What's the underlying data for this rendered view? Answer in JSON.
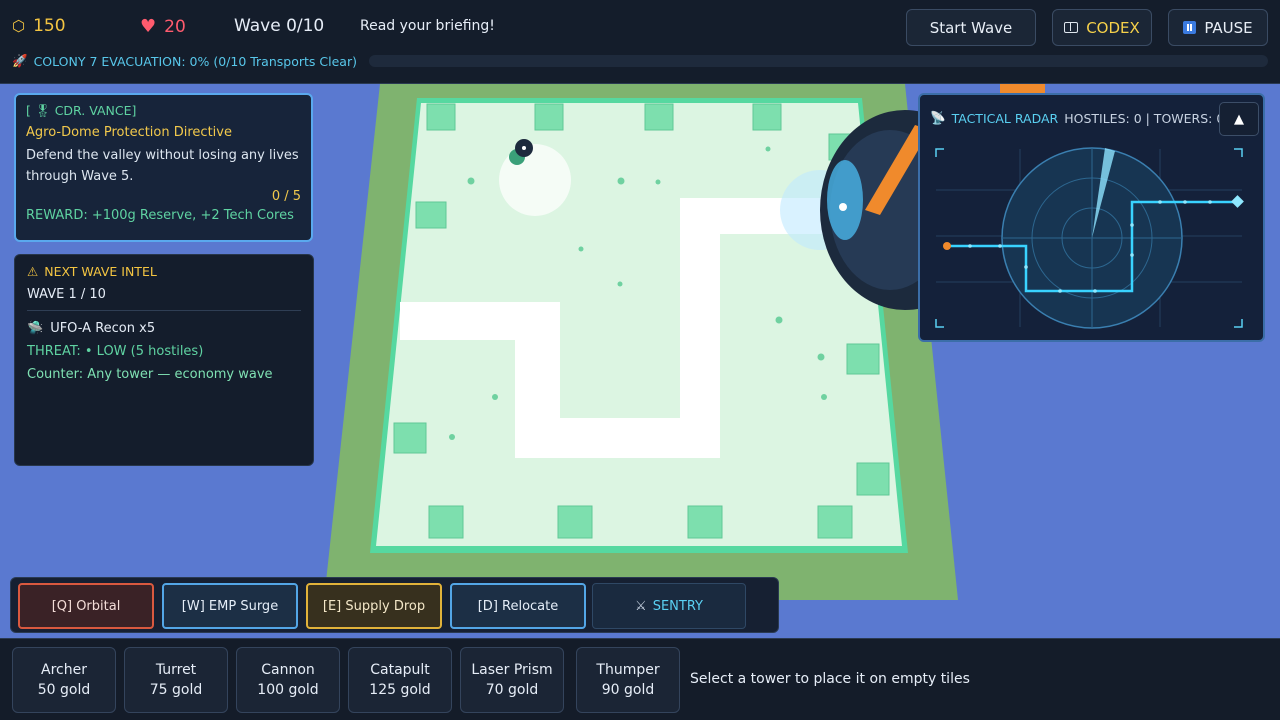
{
  "hud": {
    "gold": "150",
    "lives": "20",
    "wave": "Wave 0/10",
    "briefing": "Read your briefing!",
    "start_wave_label": "Start Wave",
    "codex_label": "CODEX",
    "pause_label": "PAUSE",
    "gold_icon": "hexagon-coin",
    "lives_icon": "heart",
    "codex_icon": "book",
    "pause_icon": "pause",
    "evacuation_text": "COLONY 7 EVACUATION: 0% (0/10 Transports Clear)",
    "evacuation_progress": 0,
    "evacuation_icon": "rocket"
  },
  "mission": {
    "commander": "[ 🎖 CDR. VANCE]",
    "title": "Agro-Dome Protection Directive",
    "description": "Defend the valley without losing any lives through Wave 5.",
    "progress": "0 / 5",
    "reward": "REWARD: +100g Reserve, +2 Tech Cores"
  },
  "intel": {
    "header": "NEXT WAVE INTEL",
    "header_icon": "warning",
    "wave": "WAVE 1 / 10",
    "enemy": "UFO-A Recon x5",
    "enemy_icon": "ufo",
    "threat": "THREAT: • LOW  (5 hostiles)",
    "counter": "Counter: Any tower — economy wave"
  },
  "radar": {
    "title": "TACTICAL RADAR",
    "stats": "HOSTILES: 0 | TOWERS: 0",
    "toggle_icon": "triangle-up",
    "toggle_label": "▲",
    "radar_icon": "satellite"
  },
  "abilities": [
    {
      "key": "orbital",
      "label": "[Q] Orbital"
    },
    {
      "key": "emp",
      "label": "[W] EMP Surge"
    },
    {
      "key": "supply",
      "label": "[E] Supply Drop"
    },
    {
      "key": "relocate",
      "label": "[D] Relocate"
    },
    {
      "key": "sentry",
      "label": "SENTRY"
    }
  ],
  "sentry_icon": "crossed-swords",
  "towers": [
    {
      "name": "Archer",
      "cost": "50 gold"
    },
    {
      "name": "Turret",
      "cost": "75 gold"
    },
    {
      "name": "Cannon",
      "cost": "100 gold"
    },
    {
      "name": "Catapult",
      "cost": "125 gold"
    },
    {
      "name": "Laser Prism",
      "cost": "70 gold"
    },
    {
      "name": "Thumper",
      "cost": "90 gold"
    }
  ],
  "tower_hint": "Select a tower to place it on empty tiles",
  "colors": {
    "gold": "#f4c542",
    "lives": "#ff5b6e",
    "accent_cyan": "#5ad0f2",
    "accent_green": "#5fd3a2",
    "field": "#dff7e6",
    "path": "#ffffff",
    "pads": "#7ddfae"
  }
}
